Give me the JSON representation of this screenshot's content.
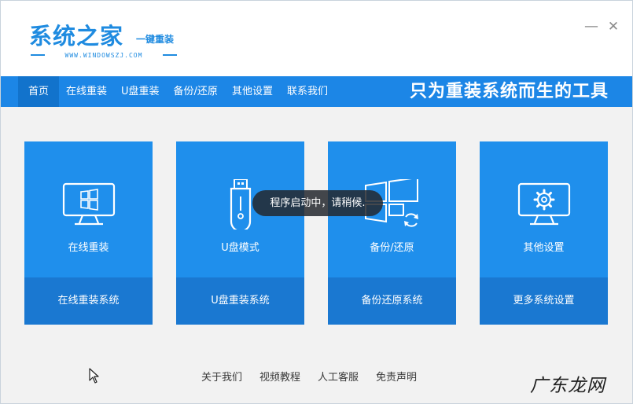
{
  "app": {
    "logo_main": "系统之家",
    "logo_sub": "一键重装",
    "logo_url": "WWW.WINDOWSZJ.COM",
    "minimize_glyph": "—",
    "close_glyph": "✕"
  },
  "nav": {
    "items": [
      {
        "label": "首页",
        "active": true
      },
      {
        "label": "在线重装"
      },
      {
        "label": "U盘重装"
      },
      {
        "label": "备份/还原"
      },
      {
        "label": "其他设置"
      },
      {
        "label": "联系我们"
      }
    ],
    "slogan": "只为重装系统而生的工具"
  },
  "cards": [
    {
      "title": "在线重装",
      "action": "在线重装系统",
      "icon": "monitor-windows-icon"
    },
    {
      "title": "U盘模式",
      "action": "U盘重装系统",
      "icon": "usb-drive-icon"
    },
    {
      "title": "备份/还原",
      "action": "备份还原系统",
      "icon": "windows-restore-icon"
    },
    {
      "title": "其他设置",
      "action": "更多系统设置",
      "icon": "monitor-gear-icon"
    }
  ],
  "toast": {
    "text": "程序启动中，请稍候."
  },
  "footer": {
    "links": [
      "关于我们",
      "视频教程",
      "人工客服",
      "免责声明"
    ]
  },
  "watermark": "广东龙网",
  "colors": {
    "brand_blue": "#1f8be0",
    "nav_blue": "#1c86e6",
    "card_blue": "#1f8fec",
    "card_bottom_blue": "#1a78d1"
  }
}
